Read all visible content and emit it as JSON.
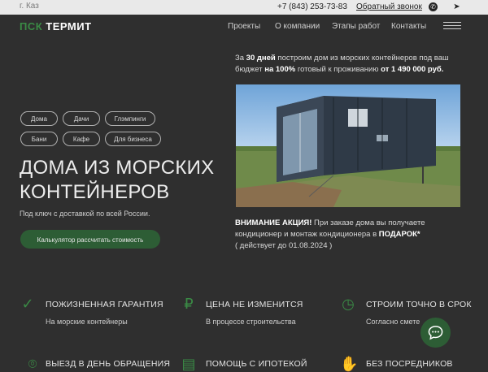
{
  "topbar": {
    "city": "г. Каз",
    "phone": "+7 (843) 253-73-83",
    "callback": "Обратный звонок",
    "social": [
      {
        "icon": "whatsapp-icon",
        "glyph": "✆"
      },
      {
        "icon": "telegram-icon",
        "glyph": "➤"
      }
    ]
  },
  "header": {
    "logo_prefix": "ПСК",
    "logo_name": "ТЕРМИТ",
    "nav": [
      "Проекты",
      "О компании",
      "Этапы работ",
      "Контакты"
    ]
  },
  "tags": [
    "Дома",
    "Дачи",
    "Глэмпинги",
    "Бани",
    "Кафе",
    "Для бизнеса"
  ],
  "hero": {
    "title": "ДОМА ИЗ МОРСКИХ КОНТЕЙНЕРОВ",
    "subtitle": "Под ключ с доставкой по всей России.",
    "cta": "Калькулятор рассчитать стоимость"
  },
  "lead": {
    "p1": "За ",
    "days": "30 дней",
    "p2": " построим дом из морских контейнеров под ваш бюджет ",
    "percent": "на 100%",
    "p3": " готовый к проживанию ",
    "price": "от 1 490 000 руб."
  },
  "promo": {
    "label": "ВНИМАНИЕ АКЦИЯ!",
    "text": " При заказе дома вы получаете кондиционер и монтаж кондиционера в ",
    "gift": "ПОДАРОК*",
    "date": "( действует до  01.08.2024 )"
  },
  "features": [
    {
      "title": "ПОЖИЗНЕННАЯ ГАРАНТИЯ",
      "text": "На морские контейнеры",
      "icon": "shield-check-icon",
      "glyph": "✓"
    },
    {
      "title": "ЦЕНА НЕ ИЗМЕНИТСЯ",
      "text": "В процессе строительства",
      "icon": "ruble-icon",
      "glyph": "₽"
    },
    {
      "title": "СТРОИМ ТОЧНО В СРОК",
      "text": "Согласно смете",
      "icon": "clock-icon",
      "glyph": "◷"
    },
    {
      "title": "ВЫЕЗД В ДЕНЬ ОБРАЩЕНИЯ",
      "text": "",
      "icon": "location-pin-icon",
      "glyph": "⌾"
    },
    {
      "title": "ПОМОЩЬ С ИПОТЕКОЙ",
      "text": "",
      "icon": "document-icon",
      "glyph": "▤"
    },
    {
      "title": "БЕЗ ПОСРЕДНИКОВ",
      "text": "",
      "icon": "handshake-icon",
      "glyph": "✋"
    }
  ],
  "colors": {
    "background": "#2f2f2f",
    "accent_green": "#2d5d35",
    "brand_green": "#3a8a45",
    "topbar": "#e9e9e9"
  }
}
